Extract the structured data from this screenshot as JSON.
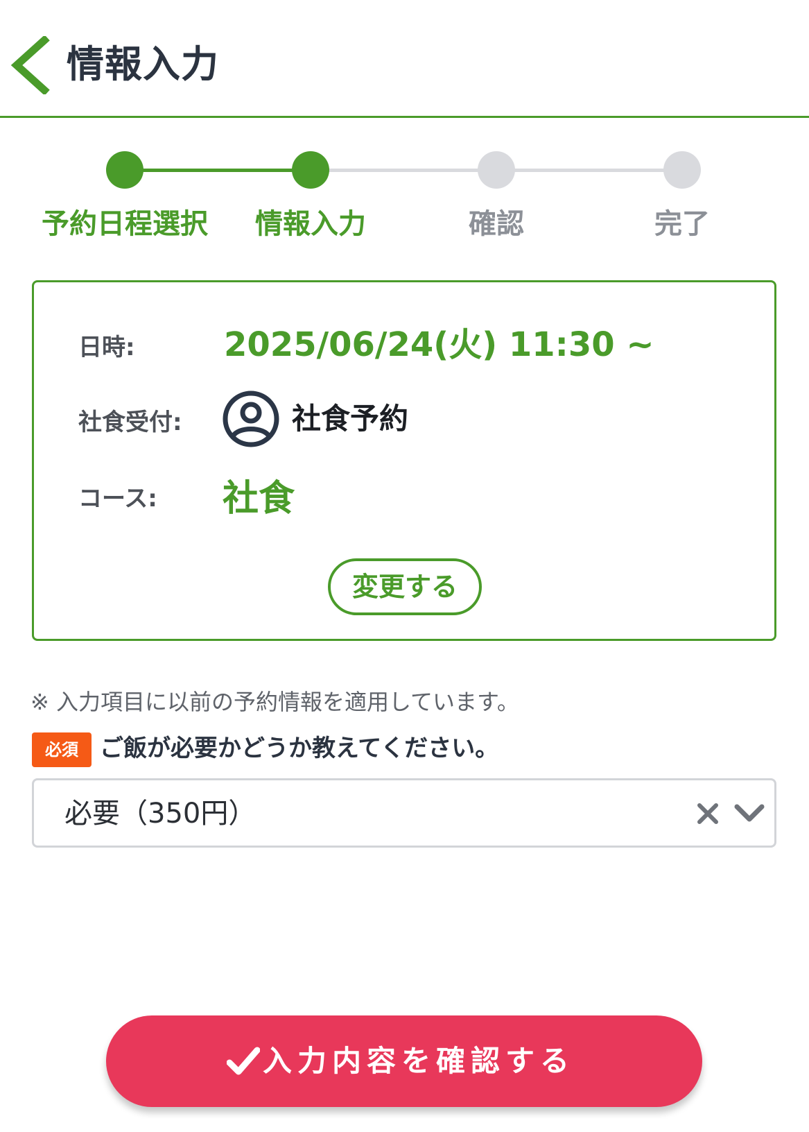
{
  "header": {
    "title": "情報入力"
  },
  "stepper": {
    "steps": [
      {
        "label": "予約日程選択",
        "state": "done"
      },
      {
        "label": "情報入力",
        "state": "current"
      },
      {
        "label": "確認",
        "state": "todo"
      },
      {
        "label": "完了",
        "state": "todo"
      }
    ]
  },
  "summary": {
    "datetime_label": "日時:",
    "datetime_value": "2025/06/24(火) 11:30 ~",
    "reception_label": "社食受付:",
    "reception_value": "社食予約",
    "reception_icon": "user-circle-icon",
    "course_label": "コース:",
    "course_value": "社食",
    "change_button": "変更する"
  },
  "form": {
    "note": "※ 入力項目に以前の予約情報を適用しています。",
    "required_badge": "必須",
    "question": "ご飯が必要かどうか教えてください。",
    "selected_value": "必要（350円）"
  },
  "footer": {
    "confirm_button": "入力内容を確認する"
  },
  "colors": {
    "accent": "#4a9b2a",
    "inactive": "#d9dade",
    "required": "#f55a16",
    "primary_button": "#e8385a"
  }
}
